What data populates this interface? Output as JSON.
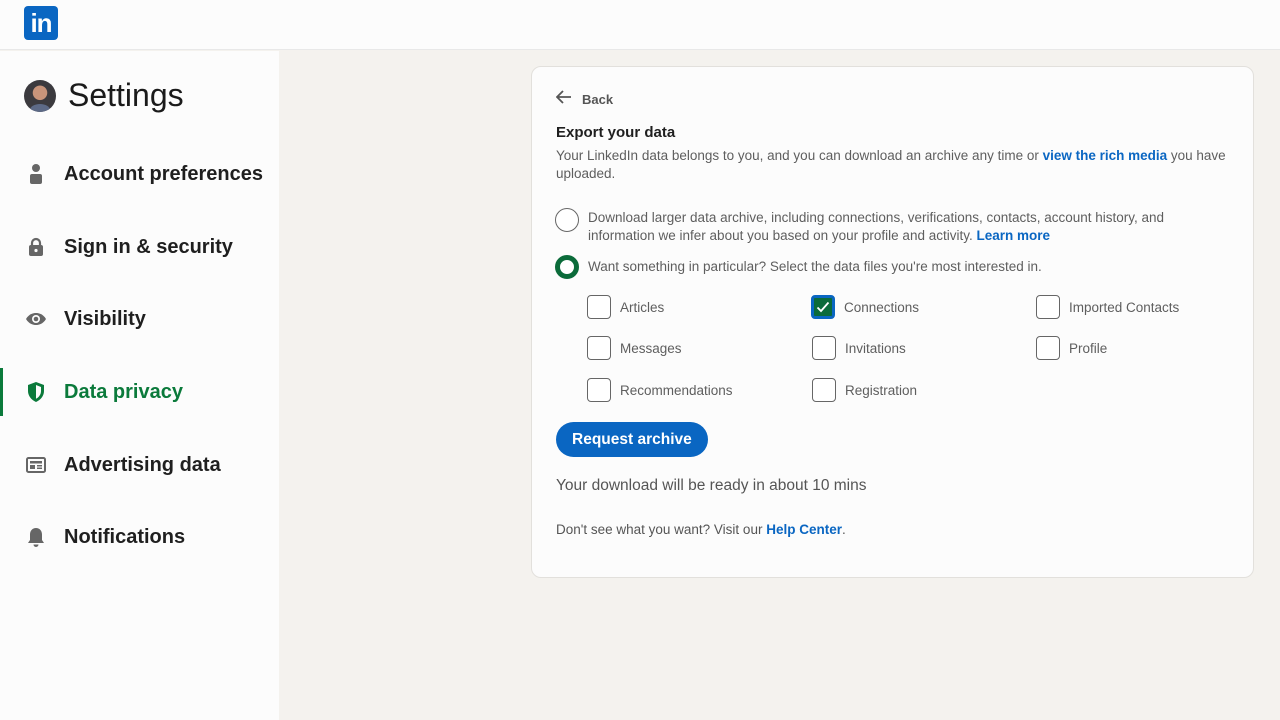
{
  "brand": {
    "logo_text": "in",
    "color": "#0a66c2"
  },
  "sidebar": {
    "title": "Settings",
    "active_color": "#0b7a3b",
    "items": [
      {
        "label": "Account preferences",
        "icon": "person-icon",
        "active": false
      },
      {
        "label": "Sign in & security",
        "icon": "lock-icon",
        "active": false
      },
      {
        "label": "Visibility",
        "icon": "eye-icon",
        "active": false
      },
      {
        "label": "Data privacy",
        "icon": "shield-icon",
        "active": true
      },
      {
        "label": "Advertising data",
        "icon": "ad-card-icon",
        "active": false
      },
      {
        "label": "Notifications",
        "icon": "bell-icon",
        "active": false
      }
    ]
  },
  "card": {
    "back_label": "Back",
    "title": "Export your data",
    "description": "Your LinkedIn data belongs to you, and you can download an archive any time or ",
    "description_link": "view the rich media",
    "description_end": " you have uploaded.",
    "options": [
      {
        "label": "Download larger data archive, including connections, verifications, contacts, account history, and information we infer about you based on your profile and activity. ",
        "link": "Learn more",
        "selected": false
      },
      {
        "label": "Want something in particular? Select the data files you're most interested in.",
        "selected": true
      }
    ],
    "checkboxes": [
      {
        "label": "Articles",
        "checked": false
      },
      {
        "label": "Connections",
        "checked": true
      },
      {
        "label": "Imported Contacts",
        "checked": false
      },
      {
        "label": "Messages",
        "checked": false
      },
      {
        "label": "Invitations",
        "checked": false
      },
      {
        "label": "Profile",
        "checked": false
      },
      {
        "label": "Recommendations",
        "checked": false
      },
      {
        "label": "Registration",
        "checked": false
      }
    ],
    "request_button": "Request archive",
    "ready_text": "Your download will be ready in about 10 mins",
    "help_text": "Don't see what you want? Visit our ",
    "help_link": "Help Center",
    "help_end": "."
  }
}
